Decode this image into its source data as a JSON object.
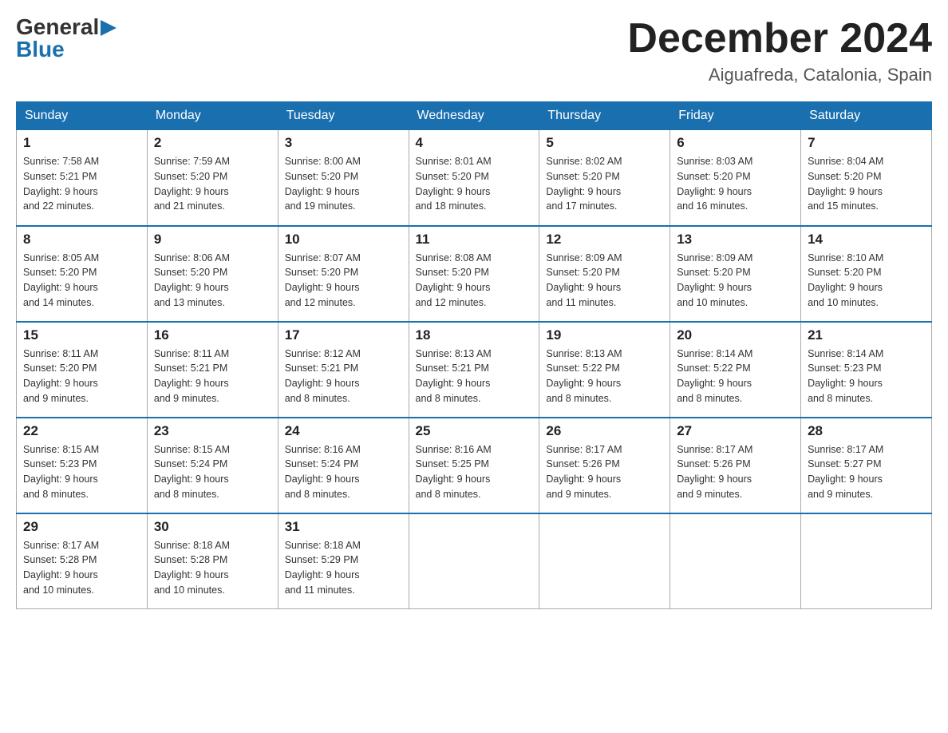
{
  "logo": {
    "general": "General",
    "blue": "Blue",
    "arrow": "▶"
  },
  "title": "December 2024",
  "subtitle": "Aiguafreda, Catalonia, Spain",
  "days_of_week": [
    "Sunday",
    "Monday",
    "Tuesday",
    "Wednesday",
    "Thursday",
    "Friday",
    "Saturday"
  ],
  "weeks": [
    [
      {
        "day": "1",
        "sunrise": "7:58 AM",
        "sunset": "5:21 PM",
        "daylight": "9 hours and 22 minutes."
      },
      {
        "day": "2",
        "sunrise": "7:59 AM",
        "sunset": "5:20 PM",
        "daylight": "9 hours and 21 minutes."
      },
      {
        "day": "3",
        "sunrise": "8:00 AM",
        "sunset": "5:20 PM",
        "daylight": "9 hours and 19 minutes."
      },
      {
        "day": "4",
        "sunrise": "8:01 AM",
        "sunset": "5:20 PM",
        "daylight": "9 hours and 18 minutes."
      },
      {
        "day": "5",
        "sunrise": "8:02 AM",
        "sunset": "5:20 PM",
        "daylight": "9 hours and 17 minutes."
      },
      {
        "day": "6",
        "sunrise": "8:03 AM",
        "sunset": "5:20 PM",
        "daylight": "9 hours and 16 minutes."
      },
      {
        "day": "7",
        "sunrise": "8:04 AM",
        "sunset": "5:20 PM",
        "daylight": "9 hours and 15 minutes."
      }
    ],
    [
      {
        "day": "8",
        "sunrise": "8:05 AM",
        "sunset": "5:20 PM",
        "daylight": "9 hours and 14 minutes."
      },
      {
        "day": "9",
        "sunrise": "8:06 AM",
        "sunset": "5:20 PM",
        "daylight": "9 hours and 13 minutes."
      },
      {
        "day": "10",
        "sunrise": "8:07 AM",
        "sunset": "5:20 PM",
        "daylight": "9 hours and 12 minutes."
      },
      {
        "day": "11",
        "sunrise": "8:08 AM",
        "sunset": "5:20 PM",
        "daylight": "9 hours and 12 minutes."
      },
      {
        "day": "12",
        "sunrise": "8:09 AM",
        "sunset": "5:20 PM",
        "daylight": "9 hours and 11 minutes."
      },
      {
        "day": "13",
        "sunrise": "8:09 AM",
        "sunset": "5:20 PM",
        "daylight": "9 hours and 10 minutes."
      },
      {
        "day": "14",
        "sunrise": "8:10 AM",
        "sunset": "5:20 PM",
        "daylight": "9 hours and 10 minutes."
      }
    ],
    [
      {
        "day": "15",
        "sunrise": "8:11 AM",
        "sunset": "5:20 PM",
        "daylight": "9 hours and 9 minutes."
      },
      {
        "day": "16",
        "sunrise": "8:11 AM",
        "sunset": "5:21 PM",
        "daylight": "9 hours and 9 minutes."
      },
      {
        "day": "17",
        "sunrise": "8:12 AM",
        "sunset": "5:21 PM",
        "daylight": "9 hours and 8 minutes."
      },
      {
        "day": "18",
        "sunrise": "8:13 AM",
        "sunset": "5:21 PM",
        "daylight": "9 hours and 8 minutes."
      },
      {
        "day": "19",
        "sunrise": "8:13 AM",
        "sunset": "5:22 PM",
        "daylight": "9 hours and 8 minutes."
      },
      {
        "day": "20",
        "sunrise": "8:14 AM",
        "sunset": "5:22 PM",
        "daylight": "9 hours and 8 minutes."
      },
      {
        "day": "21",
        "sunrise": "8:14 AM",
        "sunset": "5:23 PM",
        "daylight": "9 hours and 8 minutes."
      }
    ],
    [
      {
        "day": "22",
        "sunrise": "8:15 AM",
        "sunset": "5:23 PM",
        "daylight": "9 hours and 8 minutes."
      },
      {
        "day": "23",
        "sunrise": "8:15 AM",
        "sunset": "5:24 PM",
        "daylight": "9 hours and 8 minutes."
      },
      {
        "day": "24",
        "sunrise": "8:16 AM",
        "sunset": "5:24 PM",
        "daylight": "9 hours and 8 minutes."
      },
      {
        "day": "25",
        "sunrise": "8:16 AM",
        "sunset": "5:25 PM",
        "daylight": "9 hours and 8 minutes."
      },
      {
        "day": "26",
        "sunrise": "8:17 AM",
        "sunset": "5:26 PM",
        "daylight": "9 hours and 9 minutes."
      },
      {
        "day": "27",
        "sunrise": "8:17 AM",
        "sunset": "5:26 PM",
        "daylight": "9 hours and 9 minutes."
      },
      {
        "day": "28",
        "sunrise": "8:17 AM",
        "sunset": "5:27 PM",
        "daylight": "9 hours and 9 minutes."
      }
    ],
    [
      {
        "day": "29",
        "sunrise": "8:17 AM",
        "sunset": "5:28 PM",
        "daylight": "9 hours and 10 minutes."
      },
      {
        "day": "30",
        "sunrise": "8:18 AM",
        "sunset": "5:28 PM",
        "daylight": "9 hours and 10 minutes."
      },
      {
        "day": "31",
        "sunrise": "8:18 AM",
        "sunset": "5:29 PM",
        "daylight": "9 hours and 11 minutes."
      },
      null,
      null,
      null,
      null
    ]
  ],
  "labels": {
    "sunrise": "Sunrise:",
    "sunset": "Sunset:",
    "daylight": "Daylight:"
  }
}
